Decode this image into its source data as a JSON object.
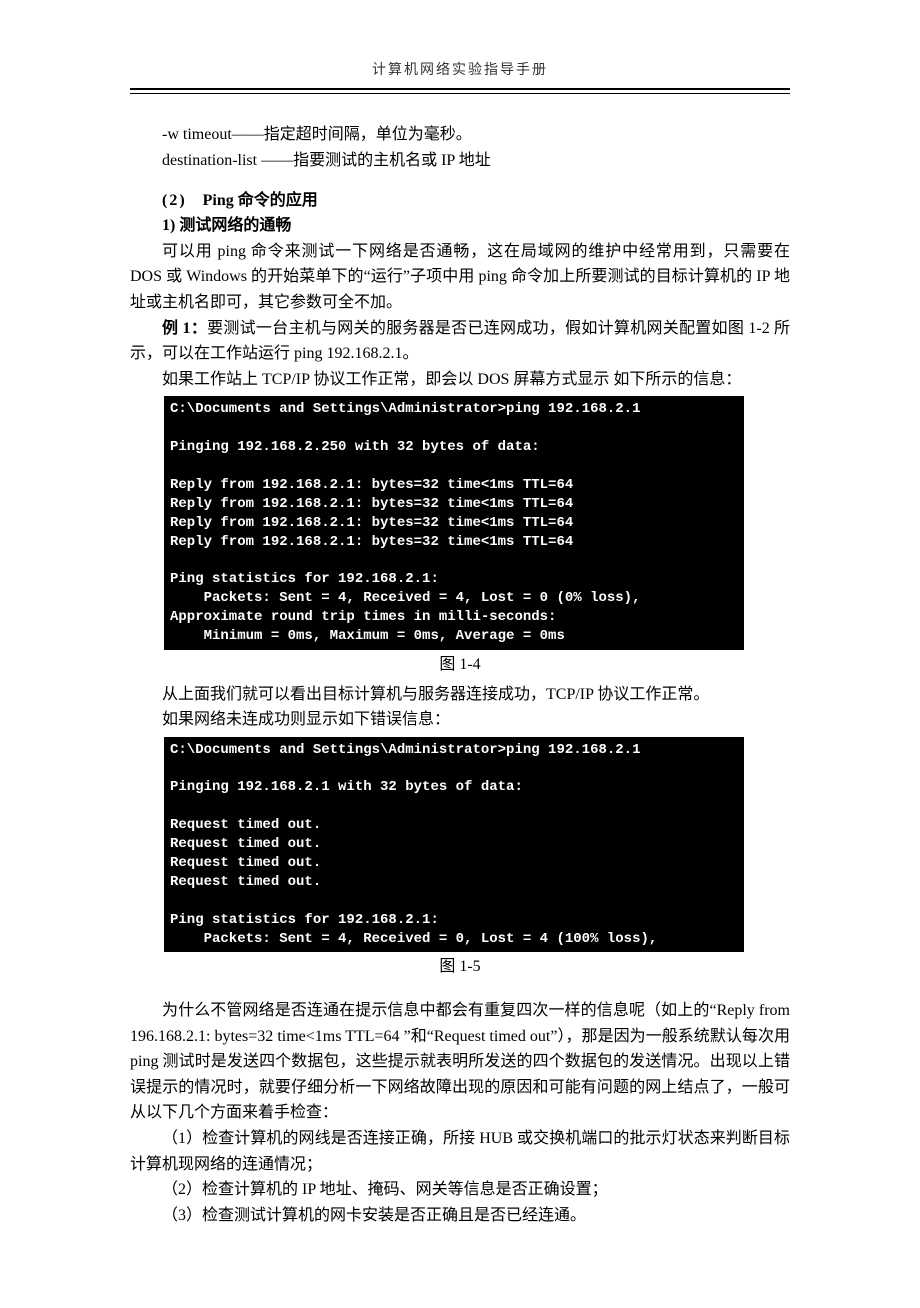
{
  "header": {
    "title": "计算机网络实验指导手册"
  },
  "intro": {
    "line1": "-w timeout——指定超时间隔，单位为毫秒。",
    "line2": "destination-list ——指要测试的主机名或 IP 地址"
  },
  "sec2": {
    "num": "(2)",
    "title": "Ping 命令的应用"
  },
  "sec2_1": {
    "num": "1)",
    "title": "测试网络的通畅"
  },
  "p1": "可以用 ping 命令来测试一下网络是否通畅，这在局域网的维护中经常用到，只需要在 DOS 或 Windows 的开始菜单下的“运行”子项中用 ping 命令加上所要测试的目标计算机的 IP 地址或主机名即可，其它参数可全不加。",
  "ex1_label": "例 1：",
  "ex1_text": "要测试一台主机与网关的服务器是否已连网成功，假如计算机网关配置如图 1-2 所示，可以在工作站运行 ping 192.168.2.1。",
  "p2": "如果工作站上 TCP/IP 协议工作正常，即会以 DOS 屏幕方式显示 如下所示的信息：",
  "console1": "C:\\Documents and Settings\\Administrator>ping 192.168.2.1\n\nPinging 192.168.2.250 with 32 bytes of data:\n\nReply from 192.168.2.1: bytes=32 time<1ms TTL=64\nReply from 192.168.2.1: bytes=32 time<1ms TTL=64\nReply from 192.168.2.1: bytes=32 time<1ms TTL=64\nReply from 192.168.2.1: bytes=32 time<1ms TTL=64\n\nPing statistics for 192.168.2.1:\n    Packets: Sent = 4, Received = 4, Lost = 0 (0% loss),\nApproximate round trip times in milli-seconds:\n    Minimum = 0ms, Maximum = 0ms, Average = 0ms",
  "cap1": "图 1-4",
  "p3": "从上面我们就可以看出目标计算机与服务器连接成功，TCP/IP 协议工作正常。",
  "p4": "如果网络未连成功则显示如下错误信息：",
  "console2": "C:\\Documents and Settings\\Administrator>ping 192.168.2.1\n\nPinging 192.168.2.1 with 32 bytes of data:\n\nRequest timed out.\nRequest timed out.\nRequest timed out.\nRequest timed out.\n\nPing statistics for 192.168.2.1:\n    Packets: Sent = 4, Received = 0, Lost = 4 (100% loss),",
  "cap2": "图 1-5",
  "p5": "为什么不管网络是否连通在提示信息中都会有重复四次一样的信息呢（如上的“Reply from 196.168.2.1: bytes=32 time<1ms TTL=64 ”和“Request timed out”），那是因为一般系统默认每次用 ping 测试时是发送四个数据包，这些提示就表明所发送的四个数据包的发送情况。出现以上错误提示的情况时，就要仔细分析一下网络故障出现的原因和可能有问题的网上结点了，一般可从以下几个方面来着手检查：",
  "b1": "（1）检查计算机的网线是否连接正确，所接 HUB 或交换机端口的批示灯状态来判断目标计算机现网络的连通情况；",
  "b2": "（2）检查计算机的 IP 地址、掩码、网关等信息是否正确设置；",
  "b3": "（3）检查测试计算机的网卡安装是否正确且是否已经连通。"
}
